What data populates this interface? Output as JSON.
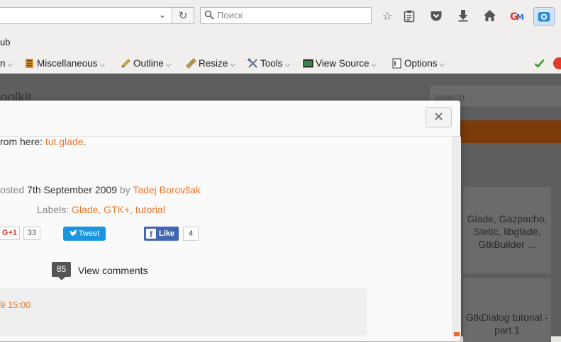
{
  "browser": {
    "search_placeholder": "Поиск",
    "bookmark_fragment": "ub"
  },
  "devbar": {
    "items": [
      {
        "label": "n"
      },
      {
        "label": "Miscellaneous"
      },
      {
        "label": "Outline"
      },
      {
        "label": "Resize"
      },
      {
        "label": "Tools"
      },
      {
        "label": "View Source"
      },
      {
        "label": "Options"
      }
    ]
  },
  "background": {
    "title_fragment": "oolkit",
    "search_placeholder": "search",
    "card1": "Glade, Gazpacho, Stetic, libglade, GtkBuilder ...",
    "card2": "GtkDialog tutorial - part 1"
  },
  "modal": {
    "close_symbol": "×",
    "download_prefix": "rom here: ",
    "download_link": "tut.glade",
    "download_suffix": ".",
    "posted_prefix": "osted ",
    "posted_date": "7th September 2009",
    "posted_by": " by ",
    "author": "Tadej Borovšak",
    "labels_prefix": "Labels: ",
    "labels": "Glade, GTK+, tutorial",
    "gplus_label": "G+1",
    "gplus_count": "33",
    "tweet_label": "Tweet",
    "fb_label": "Like",
    "fb_count": "4",
    "comment_count": "85",
    "view_comments": "View comments",
    "comment_time": "9 15:00"
  },
  "colors": {
    "accent": "#e8762d",
    "twitter": "#1b95e0",
    "facebook": "#4267b2"
  }
}
